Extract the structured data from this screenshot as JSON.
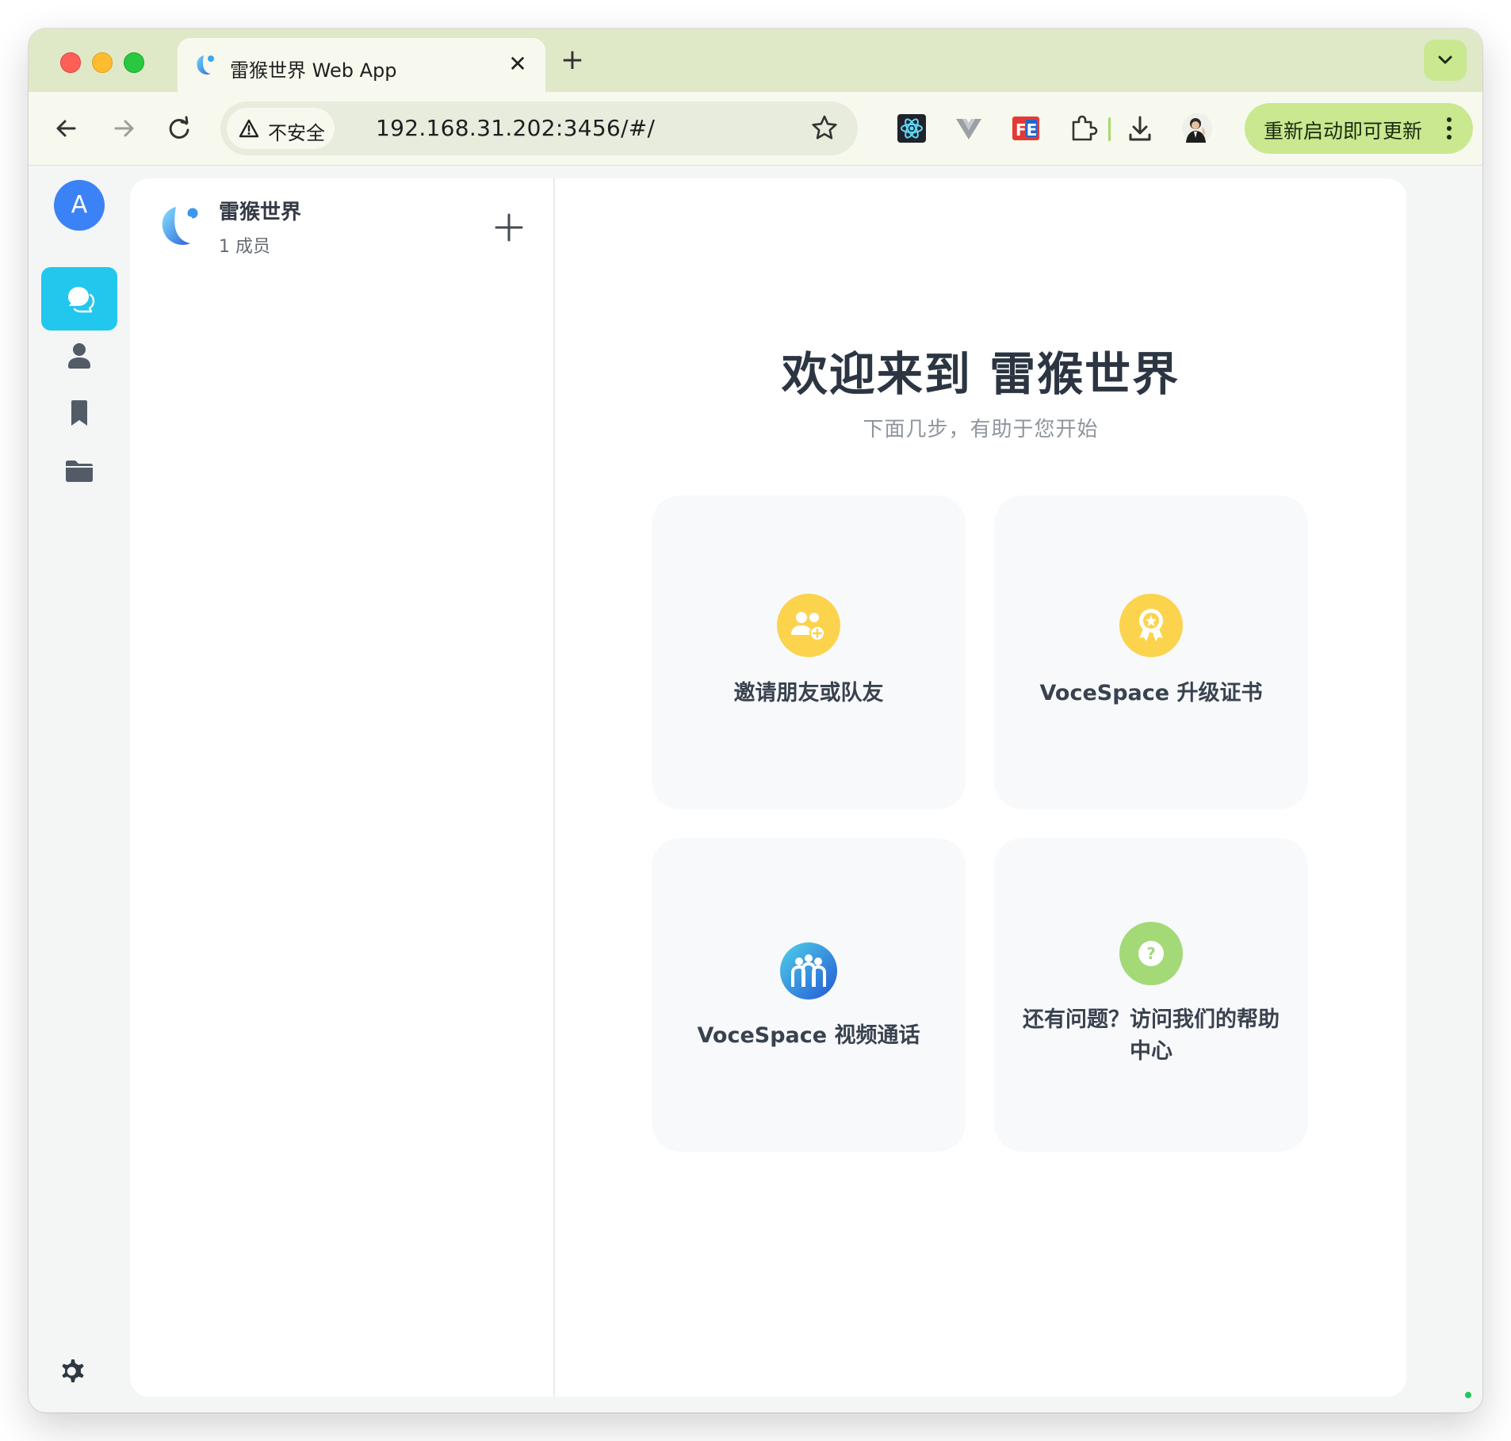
{
  "browser": {
    "tab_title": "雷猴世界 Web App",
    "tab_close": "✕",
    "new_tab": "+",
    "security_label": "不安全",
    "url": "192.168.31.202:3456/#/",
    "update_button": "重新启动即可更新"
  },
  "rail": {
    "avatar_letter": "A",
    "items": [
      "chat-icon",
      "contacts-icon",
      "bookmark-icon",
      "folder-icon"
    ],
    "active_item": "chat-icon",
    "accent_color": "#22c7ee"
  },
  "server": {
    "name": "雷猴世界",
    "members": "1 成员"
  },
  "welcome": {
    "title": "欢迎来到 雷猴世界",
    "subtitle": "下面几步，有助于您开始",
    "cards": [
      {
        "label": "邀请朋友或队友",
        "icon": "invite-friends-icon"
      },
      {
        "label": "VoceSpace 升级证书",
        "icon": "certificate-icon"
      },
      {
        "label": "VoceSpace 视频通话",
        "icon": "video-call-icon"
      },
      {
        "label": "还有问题？访问我们的帮助中心",
        "icon": "help-icon"
      }
    ]
  }
}
